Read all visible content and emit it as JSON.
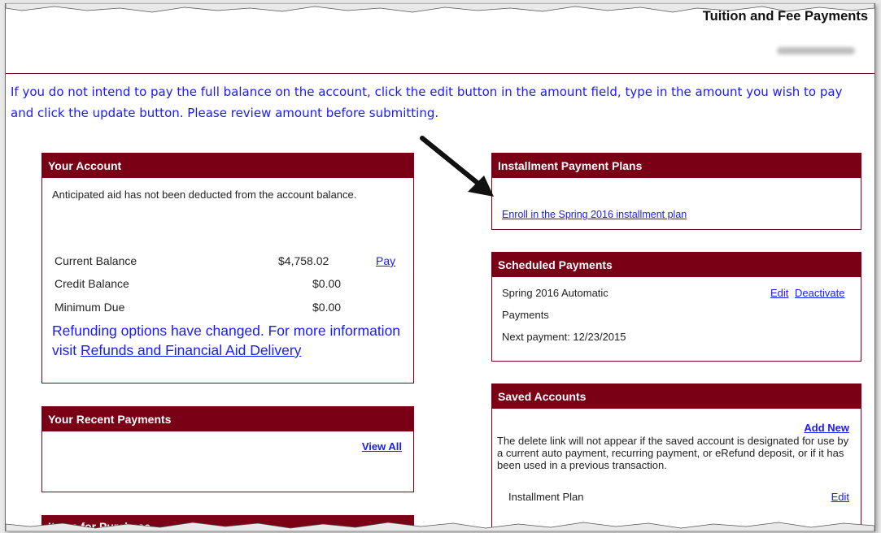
{
  "header": {
    "title": "Tuition and Fee Payments"
  },
  "instructions": "If you do not intend to pay the full balance on the account, click the edit button in the amount field, type in the amount you wish to pay and click the update button.  Please review amount before submitting.",
  "your_account": {
    "title": "Your Account",
    "note": "Anticipated aid has not been deducted from the account balance.",
    "rows": [
      {
        "label": "Current Balance",
        "value": "$4,758.02",
        "action": "Pay"
      },
      {
        "label": "Credit Balance",
        "value": "$0.00"
      },
      {
        "label": "Minimum Due",
        "value": "$0.00"
      }
    ],
    "refund_text": "Refunding options have changed.  For more information visit ",
    "refund_link": "Refunds and Financial Aid Delivery"
  },
  "recent_payments": {
    "title": "Your Recent Payments",
    "view_all": "View All"
  },
  "items_purchase": {
    "title": "Items for Purchase"
  },
  "installment": {
    "title": "Installment Payment Plans",
    "enroll_link": "Enroll in the Spring 2016 installment plan"
  },
  "scheduled": {
    "title": "Scheduled Payments",
    "name_line1": "Spring 2016 Automatic",
    "name_line2": "Payments",
    "edit": "Edit",
    "deactivate": "Deactivate",
    "next_payment": "Next payment: 12/23/2015"
  },
  "saved_accounts": {
    "title": "Saved Accounts",
    "add_new": "Add New",
    "note": "The delete link will not appear if the saved account is designated for use by a current auto payment, recurring payment, or eRefund deposit, or if it has been used in a previous transaction.",
    "item_label": "Installment Plan",
    "item_edit": "Edit"
  },
  "colors": {
    "accent": "#7a0016",
    "link": "#1a1aff"
  }
}
